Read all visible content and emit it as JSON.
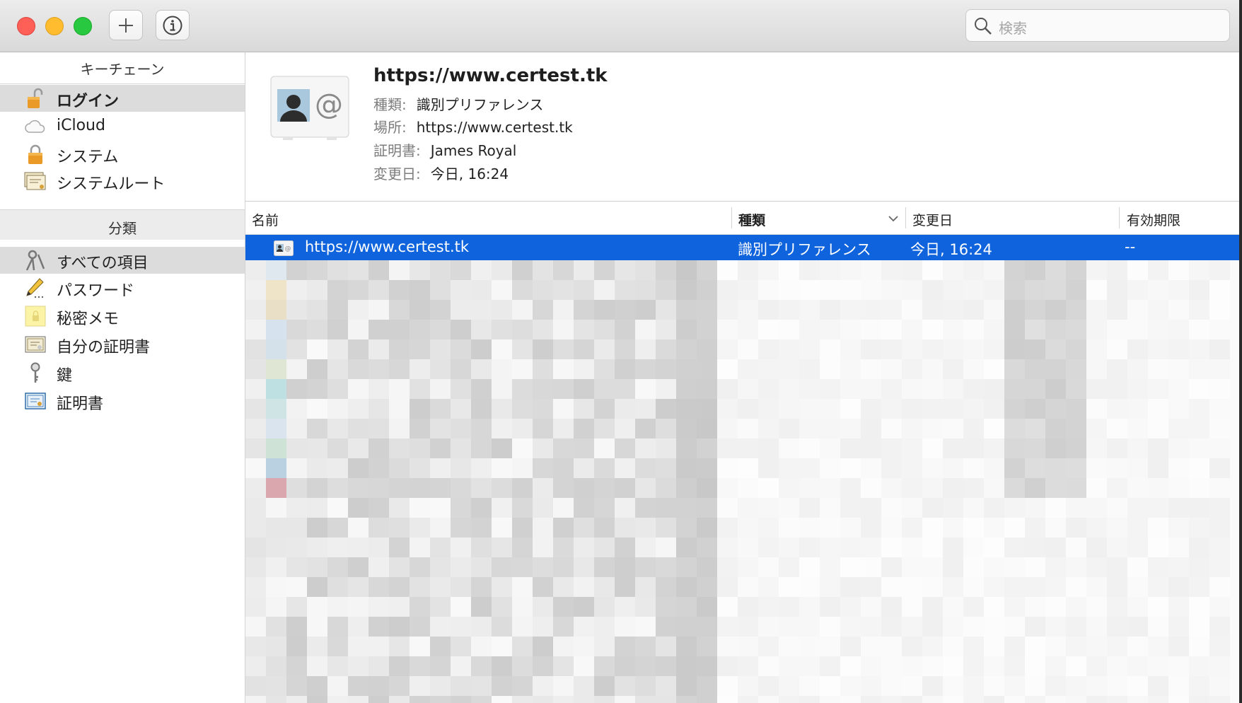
{
  "window": {
    "toolbar": {
      "add_icon": "plus-icon",
      "info_icon": "info-icon",
      "search_placeholder": "検索"
    }
  },
  "sidebar": {
    "keychain_header": "キーチェーン",
    "keychains": [
      {
        "label": "ログイン",
        "icon": "unlocked-padlock-icon",
        "selected": true
      },
      {
        "label": "iCloud",
        "icon": "cloud-icon",
        "selected": false
      },
      {
        "label": "システム",
        "icon": "locked-padlock-icon",
        "selected": false
      },
      {
        "label": "システムルート",
        "icon": "certificate-stack-icon",
        "selected": false
      }
    ],
    "category_header": "分類",
    "categories": [
      {
        "label": "すべての項目",
        "icon": "keys-icon",
        "selected": true
      },
      {
        "label": "パスワード",
        "icon": "pencil-icon",
        "selected": false
      },
      {
        "label": "秘密メモ",
        "icon": "secure-note-icon",
        "selected": false
      },
      {
        "label": "自分の証明書",
        "icon": "my-certificate-icon",
        "selected": false
      },
      {
        "label": "鍵",
        "icon": "key-icon",
        "selected": false
      },
      {
        "label": "証明書",
        "icon": "certificate-icon",
        "selected": false
      }
    ]
  },
  "detail": {
    "icon": "identity-preference-card-icon",
    "title": "https://www.certest.tk",
    "kind_label": "種類:",
    "kind_value": "識別プリファレンス",
    "where_label": "場所:",
    "where_value": "https://www.certest.tk",
    "cert_label": "証明書:",
    "cert_value": "James Royal",
    "modified_label": "変更日:",
    "modified_value": "今日, 16:24"
  },
  "table": {
    "columns": [
      {
        "label": "名前",
        "bold": false
      },
      {
        "label": "種類",
        "bold": true,
        "sort": "descending"
      },
      {
        "label": "変更日",
        "bold": false
      },
      {
        "label": "有効期限",
        "bold": false
      }
    ],
    "selected_row": {
      "icon": "identity-preference-small-icon",
      "name": "https://www.certest.tk",
      "kind": "識別プリファレンス",
      "modified": "今日, 16:24",
      "expires": "--"
    }
  },
  "colors": {
    "selection": "#0f63dc",
    "sidebar_selection": "#dcdcdc",
    "close": "#fe5f57",
    "minimize": "#febc2e",
    "zoom": "#28c840"
  }
}
